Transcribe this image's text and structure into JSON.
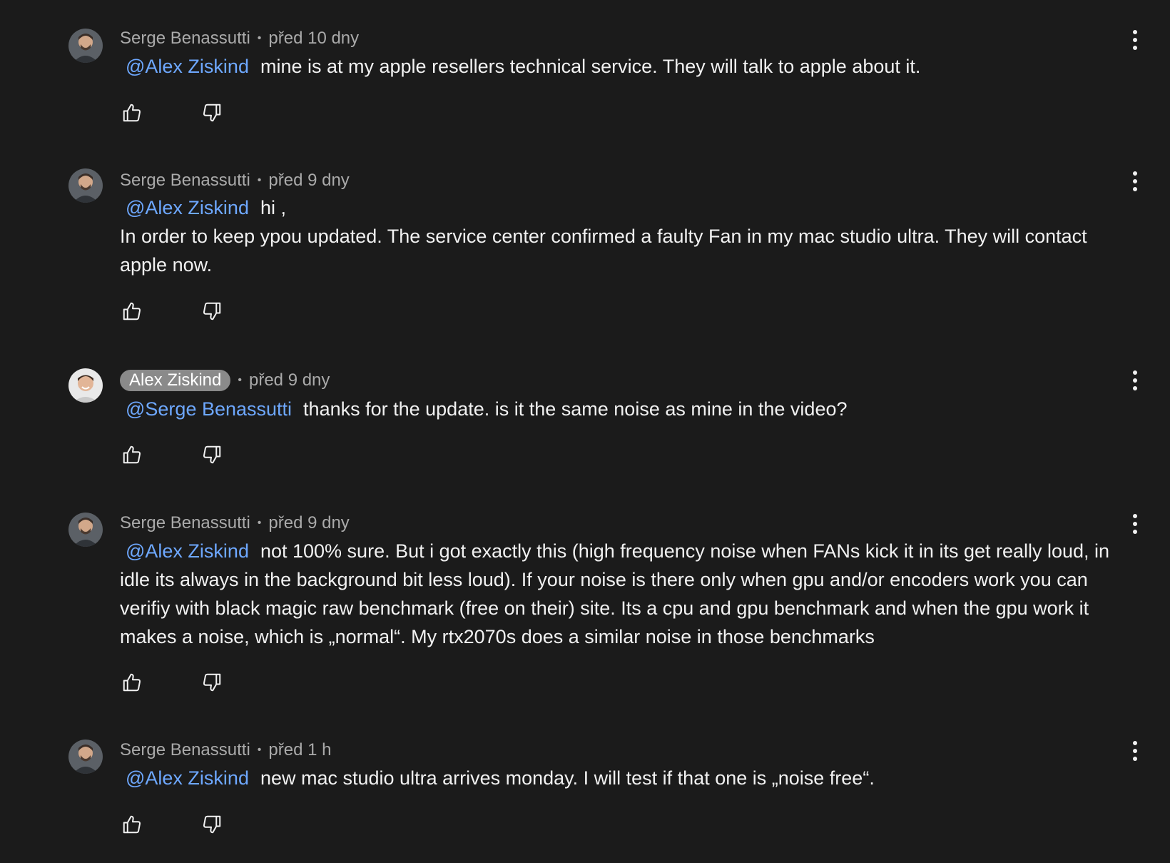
{
  "comments": [
    {
      "author": "Serge Benassutti",
      "author_is_creator": false,
      "time": "před 10 dny",
      "mention": "@Alex Ziskind",
      "text": "mine is at my apple resellers technical service. They will talk to apple about it."
    },
    {
      "author": "Serge Benassutti",
      "author_is_creator": false,
      "time": "před 9 dny",
      "mention": "@Alex Ziskind",
      "text": "hi ,",
      "text2": "In order to keep ypou updated. The service center confirmed a faulty Fan in my mac studio ultra. They will contact apple now."
    },
    {
      "author": "Alex Ziskind",
      "author_is_creator": true,
      "time": "před 9 dny",
      "mention": "@Serge Benassutti",
      "text": "thanks for the update. is it the same noise as mine in the video?"
    },
    {
      "author": "Serge Benassutti",
      "author_is_creator": false,
      "time": "před 9 dny",
      "mention": "@Alex Ziskind",
      "text": "not 100% sure. But i got exactly this (high frequency noise when FANs kick it in its get really loud, in idle its always in the background bit less loud). If your noise is there only when gpu and/or encoders work you can verifiy with black magic raw benchmark (free on their) site. Its a cpu and gpu benchmark and when the gpu work it makes a noise, which is „normal“. My rtx2070s does a similar noise in those benchmarks"
    },
    {
      "author": "Serge Benassutti",
      "author_is_creator": false,
      "time": "před 1 h",
      "mention": "@Alex Ziskind",
      "text": "new mac studio ultra arrives monday. I will test if that one is „noise free“."
    }
  ],
  "separator": "•",
  "icons": {
    "like": "thumb-up-icon",
    "dislike": "thumb-down-icon",
    "menu": "more-vertical-icon"
  },
  "colors": {
    "background": "#1b1b1b",
    "mention": "#6ea8ff",
    "meta": "#aaaaaa",
    "creator_chip": "#8a8a8a"
  }
}
